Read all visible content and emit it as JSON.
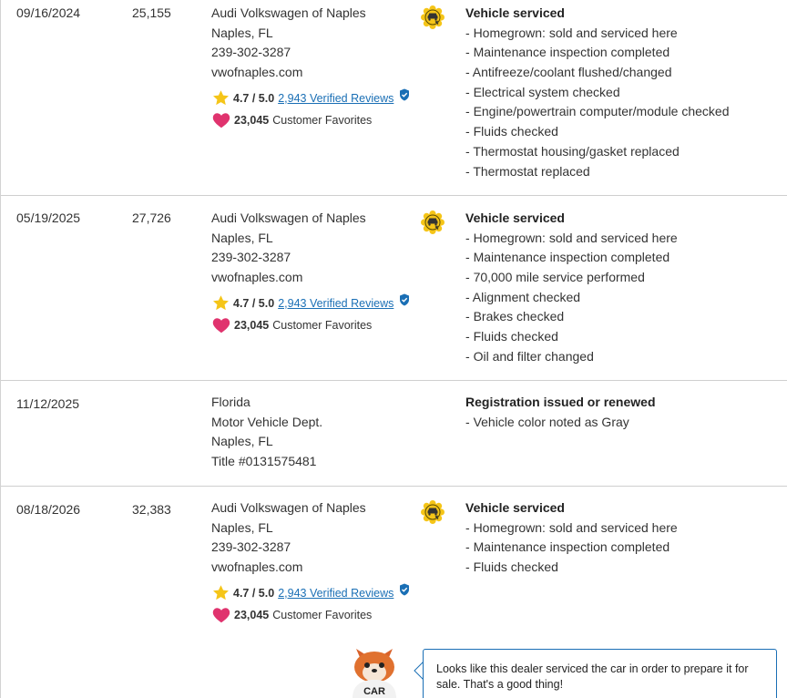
{
  "records": [
    {
      "date": "09/16/2024",
      "odometer": "25,155",
      "source": [
        "Audi Volkswagen of Naples",
        "Naples, FL",
        "239-302-3287",
        "vwofnaples.com"
      ],
      "rating": "4.7 / 5.0",
      "reviews": "2,943 Verified Reviews",
      "favorites_count": "23,045",
      "favorites_label": "Customer Favorites",
      "title": "Vehicle serviced",
      "items": [
        "Homegrown: sold and serviced here",
        "Maintenance inspection completed",
        "Antifreeze/coolant flushed/changed",
        "Electrical system checked",
        "Engine/powertrain computer/module checked",
        "Fluids checked",
        "Thermostat housing/gasket replaced",
        "Thermostat replaced"
      ]
    },
    {
      "date": "05/19/2025",
      "odometer": "27,726",
      "source": [
        "Audi Volkswagen of Naples",
        "Naples, FL",
        "239-302-3287",
        "vwofnaples.com"
      ],
      "rating": "4.7 / 5.0",
      "reviews": "2,943 Verified Reviews",
      "favorites_count": "23,045",
      "favorites_label": "Customer Favorites",
      "title": "Vehicle serviced",
      "items": [
        "Homegrown: sold and serviced here",
        "Maintenance inspection completed",
        "70,000 mile service performed",
        "Alignment checked",
        "Brakes checked",
        "Fluids checked",
        "Oil and filter changed"
      ]
    },
    {
      "date": "11/12/2025",
      "odometer": "",
      "source": [
        "Florida",
        "Motor Vehicle Dept.",
        "Naples, FL",
        "Title #0131575481"
      ],
      "title": "Registration issued or renewed",
      "items": [
        "Vehicle color noted as Gray"
      ]
    },
    {
      "date": "08/18/2026",
      "odometer": "32,383",
      "source": [
        "Audi Volkswagen of Naples",
        "Naples, FL",
        "239-302-3287",
        "vwofnaples.com"
      ],
      "rating": "4.7 / 5.0",
      "reviews": "2,943 Verified Reviews",
      "favorites_count": "23,045",
      "favorites_label": "Customer Favorites",
      "title": "Vehicle serviced",
      "items": [
        "Homegrown: sold and serviced here",
        "Maintenance inspection completed",
        "Fluids checked"
      ]
    }
  ],
  "tip": {
    "text": "Looks like this dealer serviced the car in order to prepare it for sale. That's a good thing!",
    "mascot_label": "CAR"
  },
  "icons": {
    "service_badge": "service-badge-icon",
    "star": "star-icon",
    "verified": "verified-shield-icon",
    "heart": "heart-icon"
  },
  "colors": {
    "badge": "#f5c518",
    "star": "#f5c518",
    "heart": "#e0336e",
    "link": "#1a6fb5",
    "divider": "#cfcfcf"
  }
}
